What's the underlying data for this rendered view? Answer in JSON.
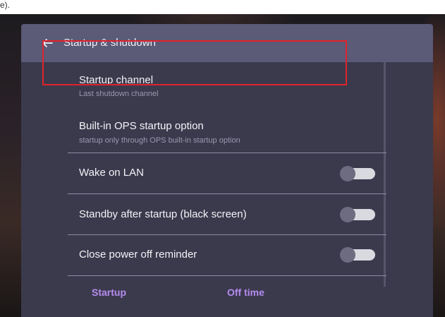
{
  "top": {
    "cutoff_text": "e)."
  },
  "header": {
    "title": "Startup & shutdown"
  },
  "items": [
    {
      "title": "Startup channel",
      "subtitle": "Last shutdown channel"
    },
    {
      "title": "Built-in OPS startup option",
      "subtitle": "startup only through OPS built-in startup option"
    },
    {
      "title": "Wake on LAN",
      "toggle": "off"
    },
    {
      "title": "Standby after startup (black screen)",
      "toggle": "off"
    },
    {
      "title": "Close power off reminder",
      "toggle": "off"
    }
  ],
  "footer": {
    "tabs": [
      "Startup",
      "Off time"
    ]
  },
  "colors": {
    "accent": "#b58cf0",
    "highlight": "#e0232b",
    "panel": "#3b3a4d",
    "header": "#5b5a77"
  }
}
